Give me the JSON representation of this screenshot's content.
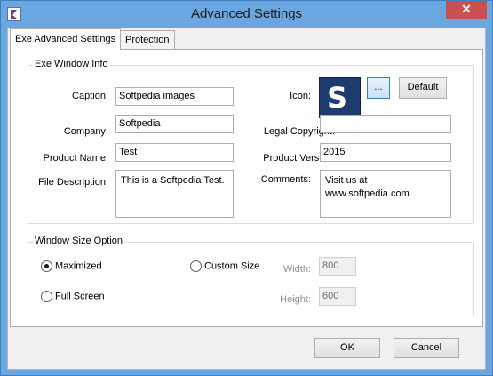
{
  "window": {
    "title": "Advanced Settings",
    "close_glyph": "✕"
  },
  "tabs": [
    {
      "label": "Exe Advanced Settings",
      "active": true
    },
    {
      "label": "Protection",
      "active": false
    }
  ],
  "exe_window_info": {
    "group_label": "Exe Window Info",
    "caption_label": "Caption:",
    "caption_value": "Softpedia images",
    "icon_label": "Icon:",
    "icon_letter": "S",
    "browse_label": "...",
    "default_label": "Default",
    "company_label": "Company:",
    "company_value": "Softpedia",
    "legal_copyright_label": "Legal Copyright:",
    "legal_copyright_value": "",
    "product_name_label": "Product Name:",
    "product_name_value": "Test",
    "product_version_label": "Product Version:",
    "product_version_value": "2015",
    "file_description_label": "File Description:",
    "file_description_value": "This is a Softpedia Test.",
    "comments_label": "Comments:",
    "comments_value": "Visit us at\nwww.softpedia.com"
  },
  "window_size_option": {
    "group_label": "Window Size Option",
    "maximized_label": "Maximized",
    "maximized_checked": true,
    "full_screen_label": "Full Screen",
    "custom_size_label": "Custom Size",
    "width_label": "Width:",
    "width_value": "800",
    "height_label": "Height:",
    "height_value": "600"
  },
  "footer": {
    "ok_label": "OK",
    "cancel_label": "Cancel"
  },
  "colors": {
    "titlebar": "#6aa6e0",
    "close_button": "#c75050",
    "icon_background": "#1d3b6e"
  },
  "icons": {
    "app": "app-icon",
    "close": "close-icon"
  }
}
